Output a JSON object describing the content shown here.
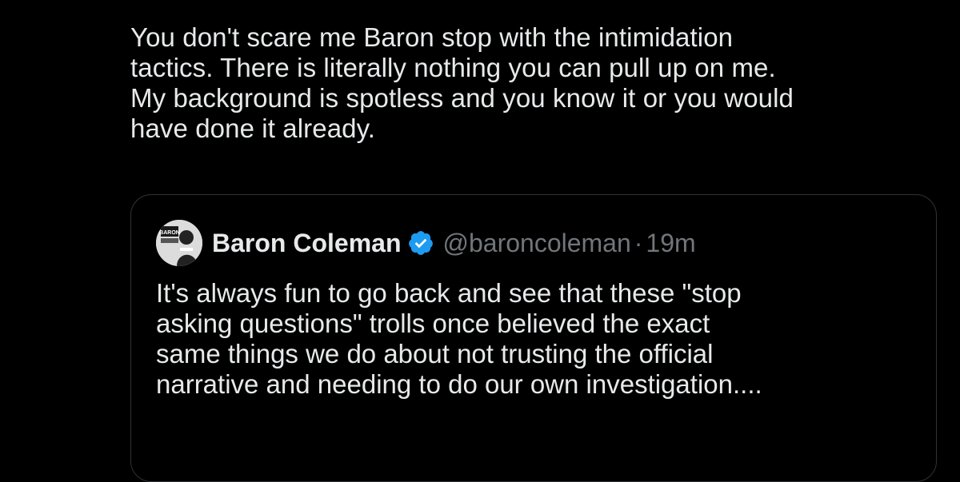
{
  "tweet": {
    "text": "You don't scare me Baron stop with the intimidation\ntactics. There is literally nothing you can pull up on me.\nMy background is spotless and you know it or you would\nhave done it already."
  },
  "quote": {
    "author_name": "Baron Coleman",
    "handle": "@baroncoleman",
    "separator": "·",
    "time": "19m",
    "verified": true,
    "avatar_icon": "baron-coleman-logo-avatar",
    "avatar_logo_text": "BARON",
    "text": "It's always fun to go back and see that these \"stop\nasking questions\" trolls once believed the exact\nsame things we do about not trusting the official\nnarrative and needing to do our own investigation...."
  },
  "colors": {
    "background": "#000000",
    "text_primary": "#e7e9ea",
    "text_secondary": "#71767b",
    "border": "#2f3336",
    "verified_blue": "#1d9bf0"
  }
}
